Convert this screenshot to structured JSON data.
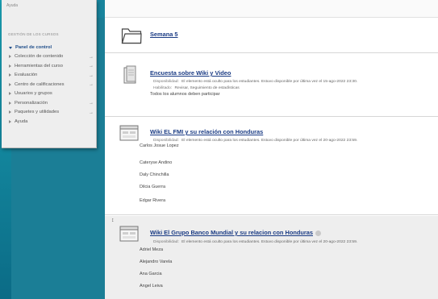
{
  "sidebar": {
    "crumb": "Ayuda",
    "section_title": "GESTIÓN DE LOS CURSOS",
    "items": [
      {
        "label": "Panel de control",
        "active": true,
        "arrow": ""
      },
      {
        "label": "Colección de contenido",
        "active": false,
        "arrow": "→"
      },
      {
        "label": "Herramientas del curso",
        "active": false,
        "arrow": "→"
      },
      {
        "label": "Evaluación",
        "active": false,
        "arrow": "→"
      },
      {
        "label": "Centro de calificaciones",
        "active": false,
        "arrow": "→"
      },
      {
        "label": "Usuarios y grupos",
        "active": false,
        "arrow": ""
      },
      {
        "label": "Personalización",
        "active": false,
        "arrow": "→"
      },
      {
        "label": "Paquetes y utilidades",
        "active": false,
        "arrow": "→"
      },
      {
        "label": "Ayuda",
        "active": false,
        "arrow": ""
      }
    ]
  },
  "content": {
    "items": [
      {
        "icon": "folder-icon",
        "title": "Semana 5"
      },
      {
        "icon": "survey-icon",
        "title": "Encuesta sobre Wiki y Video",
        "availability_label": "Disponibilidad:",
        "availability_text": "El elemento está oculto para los estudiantes. Estuvo disponible por última vez el 15-ago-2022 23:30.",
        "enabled_label": "Habilitado:",
        "enabled_text": "Revisar, Seguimiento de estadísticas",
        "note": "Todos los alumnos deben participar"
      },
      {
        "icon": "wiki-icon",
        "title": "Wiki EL FMI y su relación con Honduras",
        "availability_label": "Disponibilidad:",
        "availability_text": "El elemento está oculto para los estudiantes. Estuvo disponible por última vez el 20-ago-2022 23:59.",
        "people": [
          "Carlos Josue Lopez",
          "Cateryse Andino",
          "Daly Chinchilla",
          "Dilcia Guerra",
          "Edgar Rivera"
        ]
      },
      {
        "icon": "wiki-icon",
        "handle": "↕",
        "title": "Wiki El Grupo Banco Mundial y su relacion con Honduras",
        "availability_label": "Disponibilidad:",
        "availability_text": "El elemento está oculto para los estudiantes. Estuvo disponible por última vez el 20-ago-2022 23:59.",
        "people": [
          "Adriel Meza",
          "Alejandro Varela",
          "Ana Garcia",
          "Angel Leiva"
        ]
      }
    ]
  },
  "colors": {
    "title_link": "#1a3b84",
    "active_menu": "#1f4e8a",
    "frame": "#1b7e96"
  }
}
